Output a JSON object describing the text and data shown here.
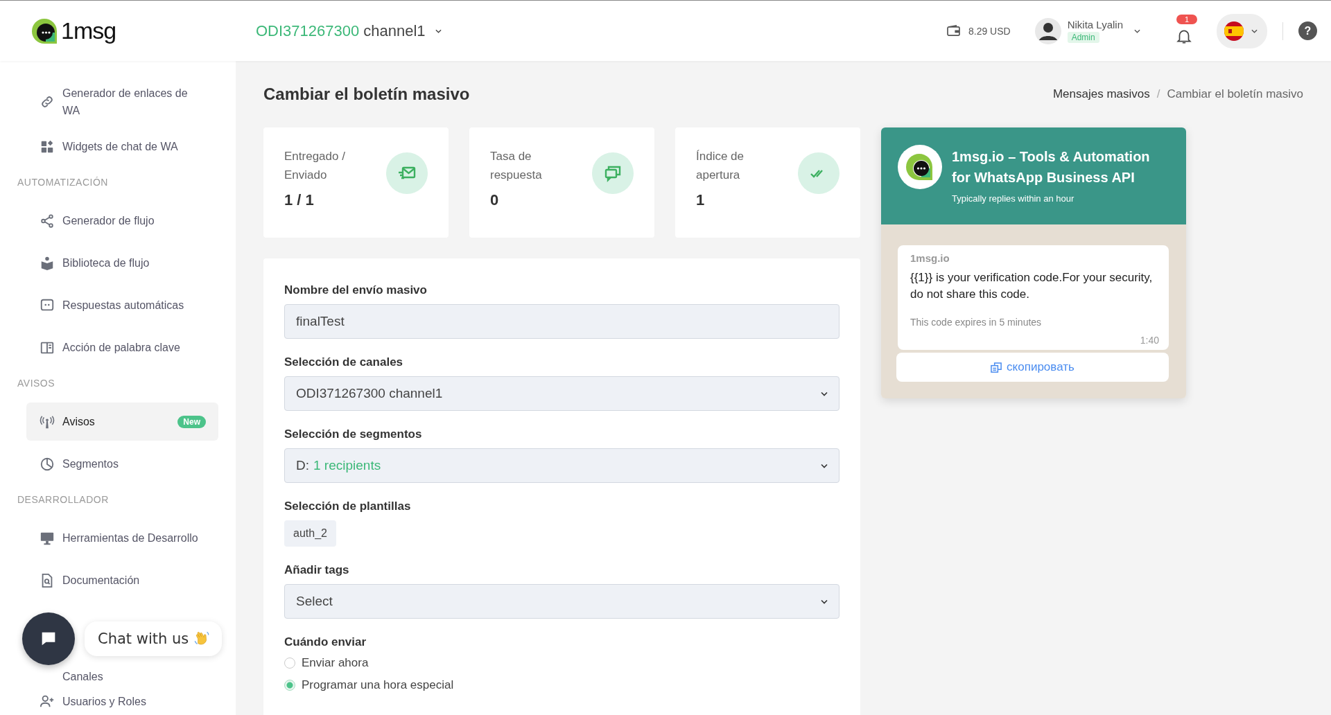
{
  "header": {
    "logo_text": "1msg",
    "channel": {
      "id": "ODI371267300",
      "name": "channel1"
    },
    "balance": "8.29 USD",
    "user": {
      "name": "Nikita Lyalin",
      "role": "Admin"
    },
    "notifications": "1",
    "help": "?"
  },
  "sidebar": [
    {
      "kind": "item",
      "label": "Generador de enlaces de WA",
      "selected": false
    },
    {
      "kind": "item",
      "label": "Widgets de chat de WA",
      "selected": false
    },
    {
      "kind": "heading",
      "label": "AUTOMATIZACIÓN"
    },
    {
      "kind": "item",
      "label": "Generador de flujo",
      "selected": false
    },
    {
      "kind": "item",
      "label": "Biblioteca de flujo",
      "selected": false
    },
    {
      "kind": "item",
      "label": "Respuestas automáticas",
      "selected": false
    },
    {
      "kind": "item",
      "label": "Acción de palabra clave",
      "selected": false
    },
    {
      "kind": "heading",
      "label": "AVISOS"
    },
    {
      "kind": "item",
      "label": "Avisos",
      "selected": true,
      "badge": "New"
    },
    {
      "kind": "item",
      "label": "Segmentos",
      "selected": false
    },
    {
      "kind": "heading",
      "label": "DESARROLLADOR"
    },
    {
      "kind": "item",
      "label": "Herramientas de Desarrollo",
      "selected": false
    },
    {
      "kind": "item",
      "label": "Documentación",
      "selected": false
    },
    {
      "kind": "gap"
    },
    {
      "kind": "item",
      "label": "Canales",
      "selected": false
    },
    {
      "kind": "item",
      "label": "Usuarios y Roles",
      "selected": false
    }
  ],
  "chat_widget": {
    "label": "Chat with us"
  },
  "page": {
    "title": "Cambiar el boletín masivo",
    "breadcrumb": [
      "Mensajes masivos",
      "Cambiar el boletín masivo"
    ],
    "breadcrumb_separator": "/"
  },
  "stats": [
    {
      "label": "Entregado / Enviado",
      "value": "1 / 1"
    },
    {
      "label": "Tasa de respuesta",
      "value": "0"
    },
    {
      "label": "Índice de apertura",
      "value": "1"
    }
  ],
  "form": [
    {
      "kind": "input",
      "label": "Nombre del envío masivo",
      "value": "finalTest"
    },
    {
      "kind": "select",
      "label": "Selección de canales",
      "value": "ODI371267300 channel1"
    },
    {
      "kind": "select",
      "label": "Selección de segmentos",
      "prefix": "D:",
      "value": "1 recipients"
    },
    {
      "kind": "chip",
      "label": "Selección de plantillas",
      "value": "auth_2"
    },
    {
      "kind": "select",
      "label": "Añadir tags",
      "placeholder": "Select"
    },
    {
      "kind": "radio",
      "label": "Cuándo enviar",
      "options": [
        {
          "label": "Enviar ahora",
          "selected": false
        },
        {
          "label": "Programar una hora especial",
          "selected": true
        }
      ]
    }
  ],
  "preview": {
    "title": "1msg.io – Tools & Automation for WhatsApp Business API",
    "subtitle": "Typically replies within an hour",
    "sender": "1msg.io",
    "body": "{{1}} is your verification code.For your security, do not share this code.",
    "footer": "This code expires in 5 minutes",
    "time": "1:40",
    "button": "скопировать"
  }
}
